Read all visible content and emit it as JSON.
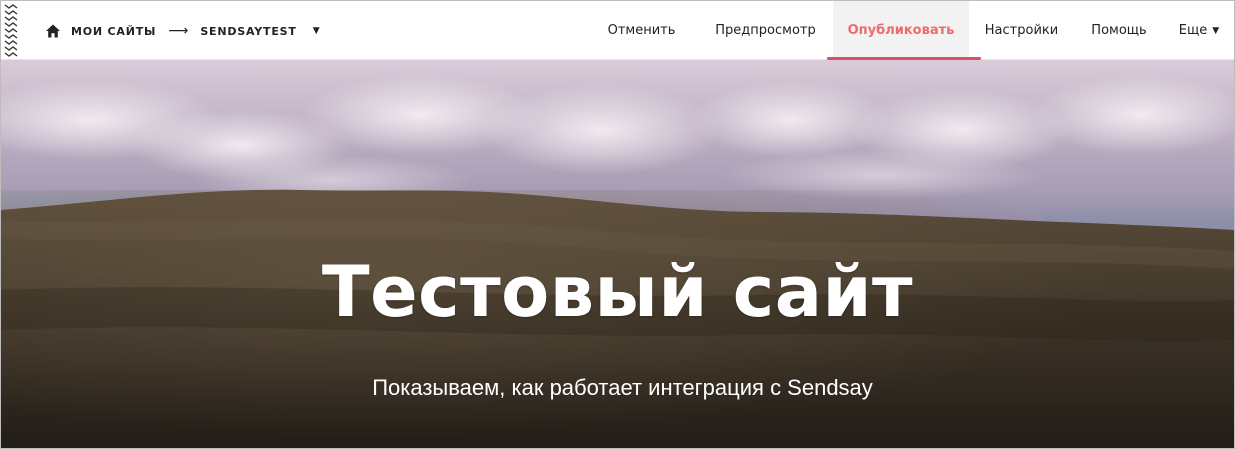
{
  "header": {
    "breadcrumb": {
      "home_icon": "home-icon",
      "my_sites": "МОИ САЙТЫ",
      "arrow": "⟶",
      "site_name": "SENDSAYTEST",
      "caret": "▼"
    },
    "nav": {
      "cancel": "Отменить",
      "preview": "Предпросмотр",
      "publish": "Опубликовать",
      "settings": "Настройки",
      "help": "Помощь",
      "more": "Еще",
      "more_caret": "▼"
    },
    "colors": {
      "publish_text": "#ef6b6b",
      "publish_underline": "#d94d6b",
      "publish_bg": "#f2f2f2"
    }
  },
  "hero": {
    "title": "Тестовый сайт",
    "subtitle": "Показываем, как работает интеграция с Sendsay"
  }
}
